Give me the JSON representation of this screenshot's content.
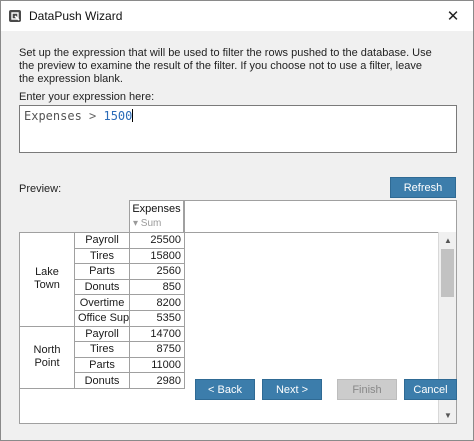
{
  "window": {
    "title": "DataPush Wizard",
    "close_glyph": "✕"
  },
  "filter": {
    "description": "Set up the expression that will be used to filter the rows pushed to the database.  Use the preview to examine the result of the filter.  If you choose not to use a filter, leave the expression blank.",
    "enter_label": "Enter your expression here:",
    "expression_field": "Expenses",
    "expression_op": " > ",
    "expression_value": "1500"
  },
  "preview": {
    "label": "Preview:",
    "refresh_label": "Refresh",
    "column_header": "Expenses",
    "column_sub": "▾ Sum",
    "groups": [
      {
        "name_line1": "Lake",
        "name_line2": "Town",
        "rows": [
          {
            "category": "Payroll",
            "value": "25500"
          },
          {
            "category": "Tires",
            "value": "15800"
          },
          {
            "category": "Parts",
            "value": "2560"
          },
          {
            "category": "Donuts",
            "value": "850"
          },
          {
            "category": "Overtime",
            "value": "8200"
          },
          {
            "category": "Office Sup",
            "value": "5350"
          }
        ]
      },
      {
        "name_line1": "North",
        "name_line2": "Point",
        "rows": [
          {
            "category": "Payroll",
            "value": "14700"
          },
          {
            "category": "Tires",
            "value": "8750"
          },
          {
            "category": "Parts",
            "value": "11000"
          },
          {
            "category": "Donuts",
            "value": "2980"
          }
        ]
      }
    ],
    "scroll_up_glyph": "▲",
    "scroll_down_glyph": "▼"
  },
  "buttons": {
    "back": "< Back",
    "next": "Next >",
    "finish": "Finish",
    "cancel": "Cancel"
  },
  "colors": {
    "accent": "#3c7dab",
    "expression_value": "#2b6cb8",
    "disabled": "#cccccc"
  }
}
